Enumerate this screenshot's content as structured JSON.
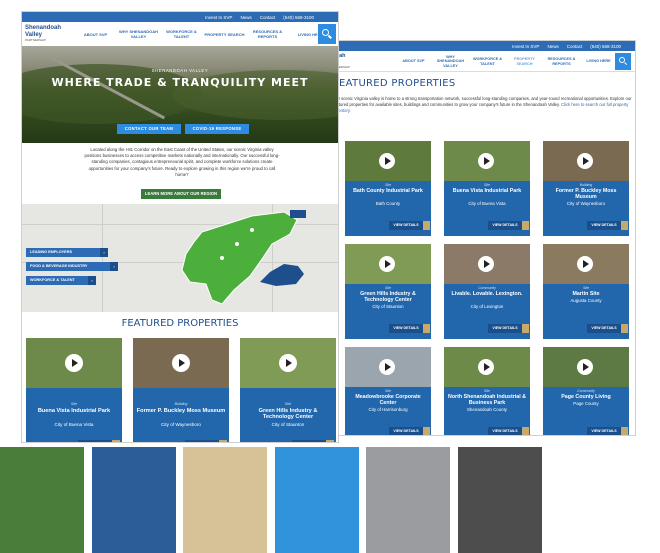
{
  "top_links": [
    "Invest In SVP",
    "News",
    "Contact",
    "(540) 568-3100"
  ],
  "logo": {
    "line1": "Shenandoah",
    "line2": "Valley",
    "line3": "PARTNERSHIP"
  },
  "back_logo": {
    "line1": "ndoah",
    "line2": "lley",
    "line3": "PARTNERSHIP"
  },
  "nav": [
    "ABOUT SVP",
    "WHY SHENANDOAH VALLEY",
    "WORKFORCE & TALENT",
    "PROPERTY SEARCH",
    "RESOURCES & REPORTS",
    "LIVING HERE"
  ],
  "hero": {
    "kicker": "SHENANDOAH VALLEY",
    "headline": "WHERE TRADE & TRANQUILITY MEET",
    "btn1": "CONTACT OUR TEAM",
    "btn2": "COVID-19 RESPONSE"
  },
  "intro": "Located along the I-81 Corridor on the East Coast of the United States, our scenic Virginia valley positions businesses to access competitive markets nationally and internationally. Our successful long-standing companies, contagious entrepreneurial spirit, and complete workforce solutions create opportunities for your company's future. Ready to explore growing in this region we're proud to call home?",
  "learn_btn": "LEARN MORE ABOUT OUR REGION",
  "map_buttons": [
    "LEADING EMPLOYERS",
    "FOOD & BEVERAGE INDUSTRY",
    "WORKFORCE & TALENT"
  ],
  "featured_title": "FEATURED PROPERTIES",
  "back_intro": "Our scenic Virginia valley is home to a strong transportation network, successful long-standing companies, and year-round recreational opportunities. Explore our featured properties for available sites, buildings and communities to grow your company's future in the Shenandoah Valley.",
  "back_intro_link": "Click here to search our full property inventory.",
  "view_details": "VIEW DETAILS",
  "front_cards": [
    {
      "cat": "Site",
      "name": "Buena Vista Industrial Park",
      "loc": "City of Buena Vista",
      "photo": "#6d8a4a"
    },
    {
      "cat": "Building",
      "name": "Former P. Buckley Moss Museum",
      "loc": "City of Waynesboro",
      "photo": "#7a6a52"
    },
    {
      "cat": "Site",
      "name": "Green Hills Industry & Technology Center",
      "loc": "City of Staunton",
      "photo": "#7f9b55"
    }
  ],
  "back_cards": [
    {
      "cat": "Site",
      "name": "Bath County Industrial Park",
      "loc": "Bath County",
      "photo": "#5f7a3d"
    },
    {
      "cat": "Site",
      "name": "Buena Vista Industrial Park",
      "loc": "City of Buena Vista",
      "photo": "#6d8a4a"
    },
    {
      "cat": "Building",
      "name": "Former P. Buckley Moss Museum",
      "loc": "City of Waynesboro",
      "photo": "#7a6a52"
    },
    {
      "cat": "Site",
      "name": "Green Hills Industry & Technology Center",
      "loc": "City of Staunton",
      "photo": "#7f9b55"
    },
    {
      "cat": "Community",
      "name": "Livable. Lovable. Lexington.",
      "loc": "City of Lexington",
      "photo": "#8b7a68"
    },
    {
      "cat": "Site",
      "name": "Martin Site",
      "loc": "Augusta County",
      "photo": "#8a7a60"
    },
    {
      "cat": "Site",
      "name": "Meadowbrooke Corporate Center",
      "loc": "City of Harrisonburg",
      "photo": "#9aa5ae"
    },
    {
      "cat": "Site",
      "name": "North Shenandoah Industrial & Business Park",
      "loc": "Shenandoah County",
      "photo": "#6e8a48"
    },
    {
      "cat": "Community",
      "name": "Page County Living",
      "loc": "Page County",
      "photo": "#5d7a44"
    }
  ],
  "colors": {
    "swatches": [
      "#4a7d39",
      "#2d5d98",
      "#d7c297",
      "#3093db",
      "#9b9c9f",
      "#4d4d4d"
    ],
    "brand_blue": "#2d6bb5",
    "accent_gold": "#c6a96b"
  }
}
